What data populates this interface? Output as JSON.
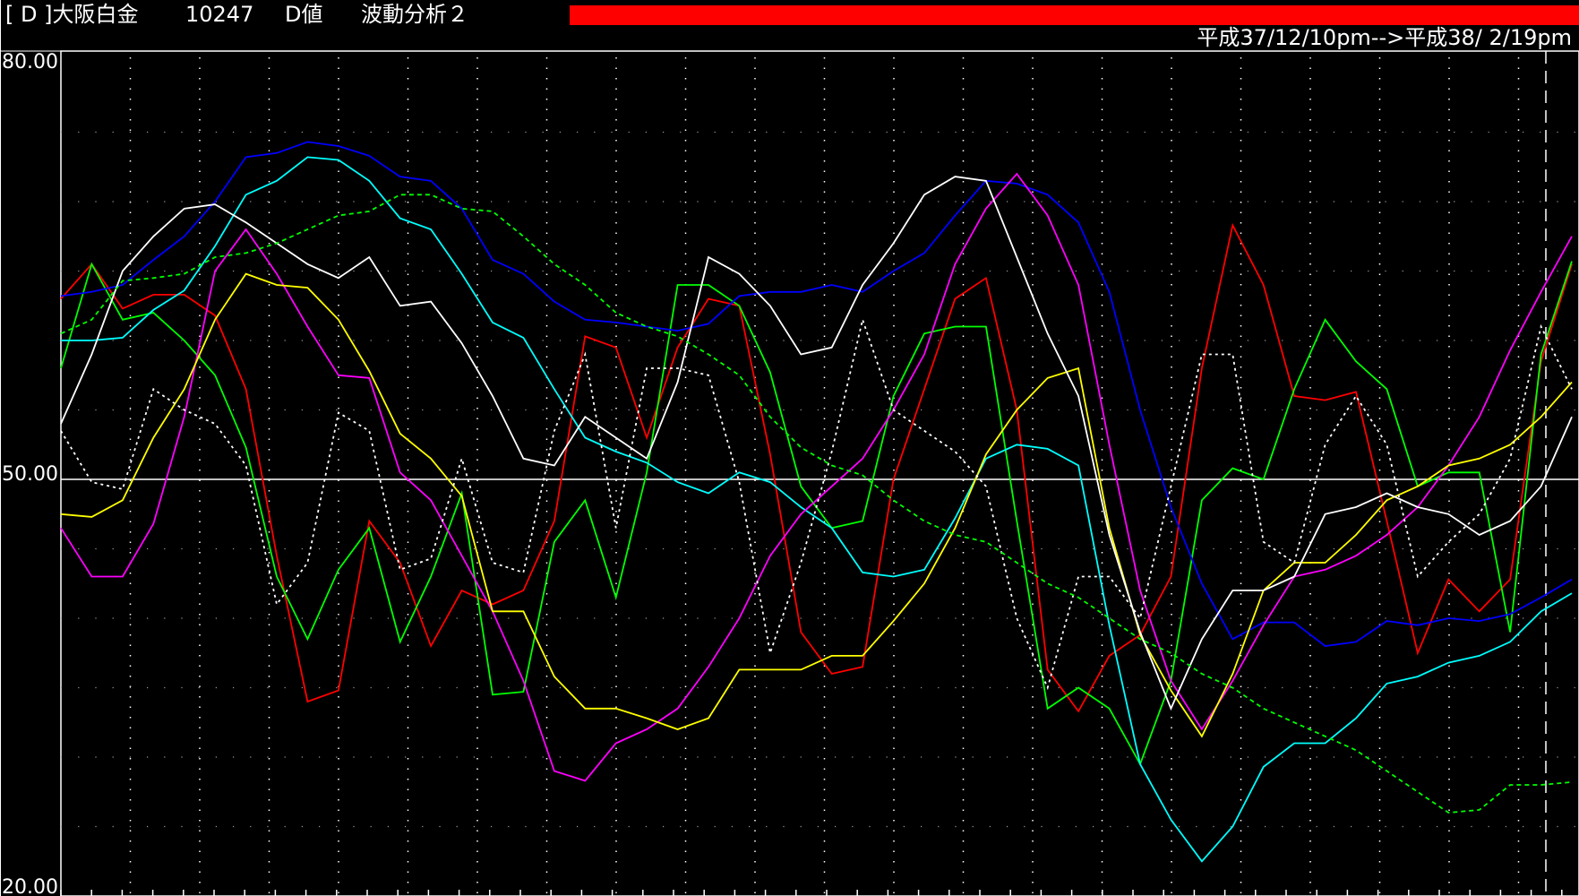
{
  "header": {
    "code": "[ D ]大阪白金",
    "number": "10247",
    "kind": "D値",
    "analysis": "波動分析２",
    "date_range": "平成37/12/10pm-->平成38/ 2/19pm",
    "status_bar_color": "#ff0000"
  },
  "chart_data": {
    "type": "line",
    "ylim": [
      20,
      80
    ],
    "yticks": [
      "80.00",
      "50.00",
      "20.00"
    ],
    "reference_line": 50,
    "grid": true,
    "x": [
      1,
      2,
      3,
      4,
      5,
      6,
      7,
      8,
      9,
      10,
      11,
      12,
      13,
      14,
      15,
      16,
      17,
      18,
      19,
      20,
      21,
      22,
      23,
      24,
      25,
      26,
      27,
      28,
      29,
      30,
      31,
      32,
      33,
      34,
      35,
      36,
      37,
      38,
      39,
      40,
      41,
      42,
      43,
      44,
      45,
      46,
      47,
      48,
      49,
      50
    ],
    "series": [
      {
        "color": "#ff0000",
        "style": "solid",
        "values": [
          63.0,
          65.5,
          62.3,
          63.3,
          63.3,
          61.8,
          56.5,
          44.5,
          34.0,
          34.8,
          47.0,
          44.0,
          38.0,
          42.0,
          41.0,
          42.0,
          47.0,
          60.3,
          59.5,
          53.0,
          59.5,
          63.0,
          62.5,
          51.8,
          39.0,
          36.0,
          36.5,
          50.0,
          56.5,
          63.0,
          64.5,
          55.0,
          36.3,
          33.3,
          37.3,
          38.8,
          43.0,
          58.0,
          68.3,
          64.0,
          56.0,
          55.7,
          56.3,
          47.0,
          37.5,
          42.8,
          40.5,
          42.8,
          58.5,
          65.5
        ]
      },
      {
        "color": "#00ff00",
        "style": "solid",
        "values": [
          58.0,
          65.5,
          61.5,
          62.0,
          60.0,
          57.5,
          52.3,
          43.0,
          38.5,
          43.5,
          46.5,
          38.3,
          43.0,
          49.0,
          34.5,
          34.7,
          45.5,
          48.5,
          41.5,
          50.5,
          64.0,
          64.0,
          62.5,
          57.7,
          49.5,
          46.5,
          47.0,
          56.0,
          60.5,
          61.0,
          61.0,
          47.0,
          33.5,
          35.0,
          33.5,
          29.5,
          35.5,
          48.5,
          50.8,
          50.0,
          56.5,
          61.5,
          58.5,
          56.5,
          49.5,
          50.5,
          50.5,
          39.0,
          59.0,
          65.7
        ]
      },
      {
        "color": "#0000ff",
        "style": "solid",
        "values": [
          63.2,
          63.5,
          64.0,
          65.8,
          67.5,
          70.0,
          73.2,
          73.5,
          74.3,
          74.0,
          73.3,
          71.8,
          71.5,
          69.5,
          65.8,
          64.8,
          62.8,
          61.5,
          61.3,
          61.0,
          60.7,
          61.2,
          63.2,
          63.5,
          63.5,
          64.0,
          63.5,
          65.0,
          66.3,
          69.0,
          71.5,
          71.3,
          70.5,
          68.5,
          63.5,
          55.0,
          48.0,
          42.5,
          38.5,
          39.7,
          39.7,
          38.0,
          38.3,
          39.8,
          39.5,
          40.0,
          39.8,
          40.3,
          41.5,
          42.8
        ]
      },
      {
        "color": "#00ffff",
        "style": "solid",
        "values": [
          60.0,
          60.0,
          60.2,
          62.2,
          63.6,
          66.8,
          70.5,
          71.5,
          73.2,
          73.0,
          71.5,
          68.8,
          68.0,
          64.8,
          61.3,
          60.2,
          56.5,
          53.0,
          52.0,
          51.2,
          49.8,
          49.0,
          50.5,
          49.8,
          48.0,
          46.5,
          43.3,
          43.0,
          43.5,
          47.2,
          51.5,
          52.5,
          52.2,
          51.0,
          39.5,
          29.5,
          25.5,
          22.5,
          25.0,
          29.3,
          31.0,
          31.0,
          32.8,
          35.3,
          35.8,
          36.8,
          37.3,
          38.3,
          40.5,
          41.8
        ]
      },
      {
        "color": "#ff00ff",
        "style": "solid",
        "values": [
          46.5,
          43.0,
          43.0,
          46.8,
          54.5,
          65.0,
          68.0,
          64.8,
          61.0,
          57.5,
          57.3,
          50.5,
          48.5,
          44.5,
          40.5,
          35.5,
          29.0,
          28.3,
          31.0,
          32.0,
          33.5,
          36.5,
          40.0,
          44.5,
          47.5,
          49.5,
          51.5,
          55.0,
          59.0,
          65.5,
          69.5,
          72.0,
          69.0,
          64.0,
          52.5,
          42.0,
          35.5,
          32.0,
          35.5,
          39.5,
          43.0,
          43.5,
          44.5,
          46.0,
          48.0,
          51.0,
          54.5,
          59.3,
          63.5,
          67.5
        ]
      },
      {
        "color": "#ffff00",
        "style": "solid",
        "values": [
          47.5,
          47.3,
          48.5,
          53.0,
          56.5,
          61.5,
          64.8,
          64.0,
          63.8,
          61.5,
          57.8,
          53.3,
          51.5,
          48.8,
          40.5,
          40.5,
          35.8,
          33.5,
          33.5,
          32.8,
          32.0,
          32.8,
          36.3,
          36.3,
          36.3,
          37.3,
          37.3,
          39.8,
          42.5,
          46.5,
          51.8,
          55.0,
          57.3,
          58.0,
          46.5,
          38.8,
          34.8,
          31.5,
          36.0,
          42.0,
          44.0,
          44.0,
          46.0,
          48.5,
          49.5,
          51.0,
          51.5,
          52.5,
          54.5,
          57.0
        ]
      },
      {
        "color": "#ffffff",
        "style": "solid",
        "values": [
          54.0,
          59.0,
          65.0,
          67.5,
          69.5,
          69.8,
          68.5,
          67.0,
          65.5,
          64.5,
          66.0,
          62.5,
          62.8,
          59.8,
          56.0,
          51.5,
          51.0,
          54.5,
          53.0,
          51.5,
          57.0,
          66.0,
          64.8,
          62.5,
          59.0,
          59.5,
          64.0,
          67.0,
          70.5,
          71.8,
          71.5,
          66.0,
          60.5,
          56.0,
          46.0,
          39.0,
          33.5,
          38.5,
          42.0,
          42.0,
          43.0,
          47.5,
          48.0,
          49.0,
          48.0,
          47.5,
          46.0,
          47.0,
          49.5,
          54.5
        ]
      },
      {
        "color": "#ffffff",
        "style": "dotted",
        "values": [
          53.5,
          49.8,
          49.3,
          56.5,
          55.0,
          54.0,
          51.0,
          41.0,
          44.0,
          54.8,
          53.5,
          43.5,
          44.3,
          51.5,
          44.0,
          43.3,
          53.5,
          59.0,
          46.5,
          58.0,
          58.0,
          57.5,
          49.8,
          37.5,
          44.0,
          52.0,
          61.5,
          55.0,
          53.5,
          52.0,
          49.5,
          40.0,
          35.0,
          43.0,
          43.0,
          40.0,
          49.5,
          59.0,
          59.0,
          45.5,
          44.0,
          52.5,
          56.0,
          52.5,
          43.0,
          45.5,
          47.5,
          51.5,
          61.0,
          56.5
        ]
      },
      {
        "color": "#00ff00",
        "style": "dashed",
        "values": [
          60.5,
          61.5,
          64.3,
          64.5,
          64.8,
          66.0,
          66.3,
          67.0,
          68.0,
          69.0,
          69.3,
          70.5,
          70.5,
          69.5,
          69.3,
          67.5,
          65.5,
          64.0,
          62.0,
          61.0,
          60.3,
          59.0,
          57.5,
          54.5,
          52.3,
          51.0,
          50.3,
          48.5,
          47.0,
          46.0,
          45.5,
          44.0,
          42.5,
          41.5,
          40.0,
          38.5,
          37.5,
          36.0,
          35.0,
          33.5,
          32.5,
          31.5,
          30.5,
          29.0,
          27.5,
          26.0,
          26.2,
          28.0,
          28.0,
          28.2
        ]
      }
    ]
  }
}
